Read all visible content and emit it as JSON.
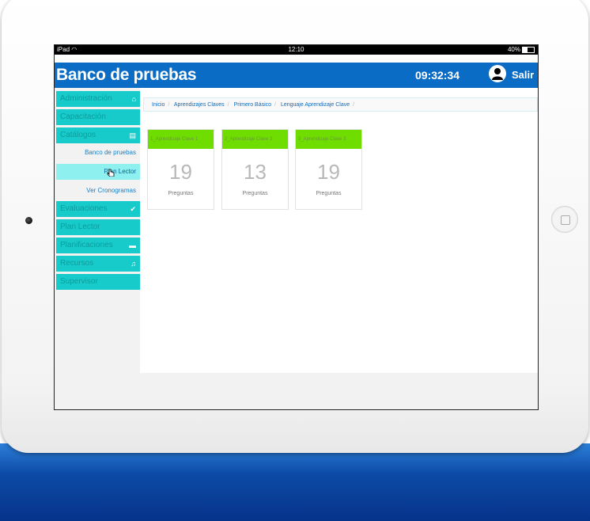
{
  "statusbar": {
    "device": "iPad",
    "time": "12:10",
    "battery": "40%"
  },
  "header": {
    "title": "Banco de pruebas",
    "clock": "09:32:34",
    "logout": "Salir"
  },
  "sidebar": {
    "items": [
      {
        "label": "Administración",
        "icon": "home-icon"
      },
      {
        "label": "Capacitación",
        "icon": ""
      },
      {
        "label": "Catálogos",
        "icon": "document-icon"
      },
      {
        "label": "Evaluaciones",
        "icon": "check-icon"
      },
      {
        "label": "Plan Lector",
        "icon": ""
      },
      {
        "label": "Planificaciones",
        "icon": "folder-icon"
      },
      {
        "label": "Recursos",
        "icon": "music-icon"
      },
      {
        "label": "Supervisor",
        "icon": ""
      }
    ],
    "subitems": [
      {
        "label": "Banco de pruebas"
      },
      {
        "label": "Plan Lector"
      },
      {
        "label": "Ver Cronogramas"
      }
    ]
  },
  "breadcrumb": [
    "Inicio",
    "Aprendizajes Claves",
    "Primero Básico",
    "Lenguaje Aprendizaje Clave"
  ],
  "cards": [
    {
      "title": "1_Aprendizaje Clave 1",
      "count": "19",
      "label": "Preguntas"
    },
    {
      "title": "2_Aprendizaje Clave 2",
      "count": "13",
      "label": "Preguntas"
    },
    {
      "title": "3_Aprendizaje Clave 3",
      "count": "19",
      "label": "Preguntas"
    }
  ],
  "colors": {
    "appbar": "#0a6cc4",
    "menu": "#18cbcb",
    "card_header": "#6fdd00",
    "bottom_glow": "#0c4aa6"
  }
}
